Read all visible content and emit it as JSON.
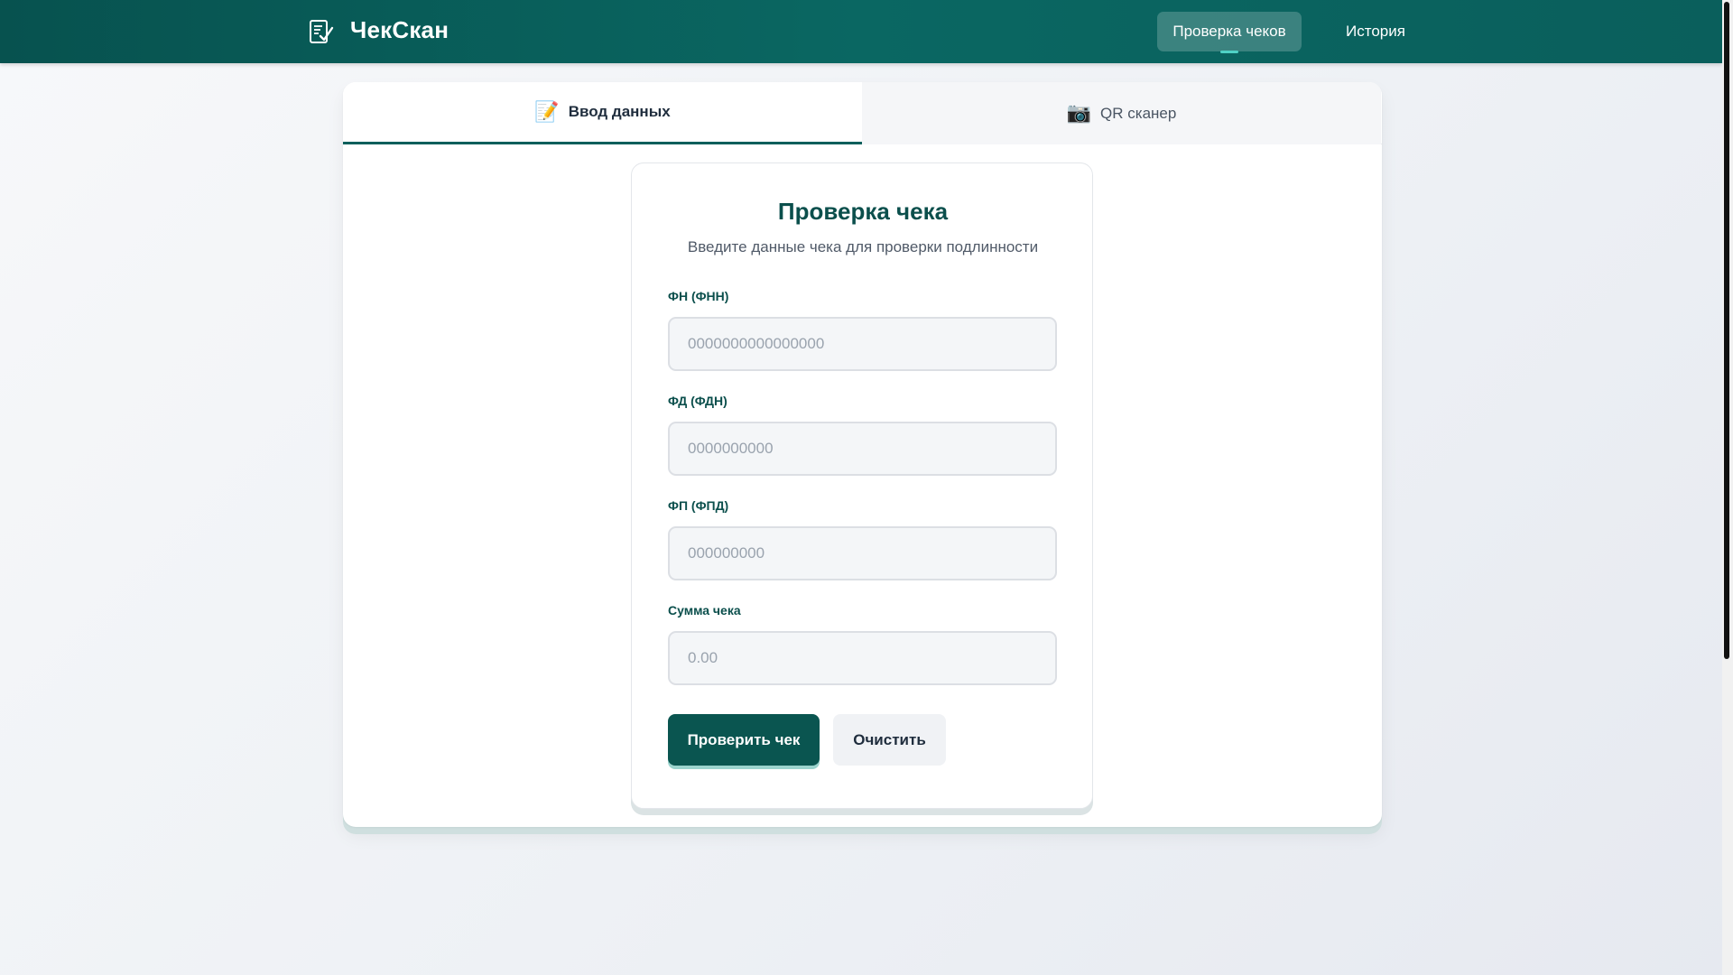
{
  "header": {
    "app_name": "ЧекСкан",
    "logo_icon": "receipt-check-icon",
    "nav": [
      {
        "label": "Проверка чеков",
        "active": true
      },
      {
        "label": "История",
        "active": false
      }
    ]
  },
  "tabs": [
    {
      "icon": "📝",
      "label": "Ввод данных",
      "active": true
    },
    {
      "icon": "📷",
      "label": "QR сканер",
      "active": false
    }
  ],
  "form": {
    "title": "Проверка чека",
    "subtitle": "Введите данные чека для проверки подлинности",
    "fields": [
      {
        "label": "ФН (ФНН)",
        "placeholder": "0000000000000000",
        "value": ""
      },
      {
        "label": "ФД (ФДН)",
        "placeholder": "0000000000",
        "value": ""
      },
      {
        "label": "ФП (ФПД)",
        "placeholder": "000000000",
        "value": ""
      },
      {
        "label": "Сумма чека",
        "placeholder": "0.00",
        "value": ""
      }
    ],
    "submit_label": "Проверить чек",
    "clear_label": "Очистить"
  },
  "colors": {
    "header_bg": "#0a5f5c",
    "primary": "#0a5550",
    "accent": "#4fd1c5"
  }
}
